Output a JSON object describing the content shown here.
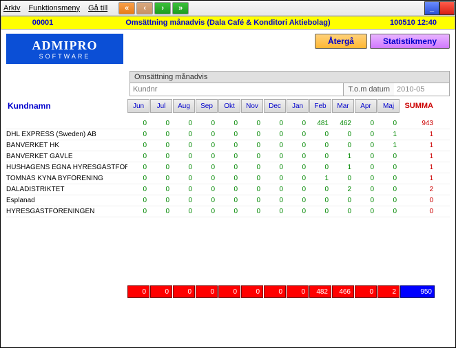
{
  "menu": {
    "arkiv": "Arkiv",
    "funk": "Funktionsmeny",
    "goto": "Gå till"
  },
  "header": {
    "left": "00001",
    "center": "Omsättning månadvis (Dala Café & Konditori Aktiebolag)",
    "right": "100510 12:40"
  },
  "logo": {
    "main": "ADMIPRO",
    "sub": "SOFTWARE"
  },
  "buttons": {
    "return": "Återgå",
    "stats": "Statistikmeny"
  },
  "filter": {
    "title": "Omsättning månadvis",
    "kundnr_ph": "Kundnr",
    "tom_lbl": "T.o.m datum",
    "tom_val": "2010-05"
  },
  "cols": {
    "kund": "Kundnamn",
    "months": [
      "Jun",
      "Jul",
      "Aug",
      "Sep",
      "Okt",
      "Nov",
      "Dec",
      "Jan",
      "Feb",
      "Mar",
      "Apr",
      "Maj"
    ],
    "summa": "SUMMA"
  },
  "rows": [
    {
      "name": "",
      "v": [
        0,
        0,
        0,
        0,
        0,
        0,
        0,
        0,
        481,
        462,
        0,
        0
      ],
      "sum": 943
    },
    {
      "name": "DHL EXPRESS (Sweden) AB",
      "v": [
        0,
        0,
        0,
        0,
        0,
        0,
        0,
        0,
        0,
        0,
        0,
        1
      ],
      "sum": 1
    },
    {
      "name": "BANVERKET HK",
      "v": [
        0,
        0,
        0,
        0,
        0,
        0,
        0,
        0,
        0,
        0,
        0,
        1
      ],
      "sum": 1
    },
    {
      "name": "BANVERKET GÄVLE",
      "v": [
        0,
        0,
        0,
        0,
        0,
        0,
        0,
        0,
        0,
        1,
        0,
        0
      ],
      "sum": 1
    },
    {
      "name": "HUSHAGENS EGNA HYRESGÄSTFÖR",
      "v": [
        0,
        0,
        0,
        0,
        0,
        0,
        0,
        0,
        0,
        1,
        0,
        0
      ],
      "sum": 1
    },
    {
      "name": "TOMNÄS KYNA BYFÖRENING ",
      "v": [
        0,
        0,
        0,
        0,
        0,
        0,
        0,
        0,
        1,
        0,
        0,
        0
      ],
      "sum": 1
    },
    {
      "name": "DALADISTRIKTET",
      "v": [
        0,
        0,
        0,
        0,
        0,
        0,
        0,
        0,
        0,
        2,
        0,
        0
      ],
      "sum": 2
    },
    {
      "name": "Esplanad",
      "v": [
        0,
        0,
        0,
        0,
        0,
        0,
        0,
        0,
        0,
        0,
        0,
        0
      ],
      "sum": 0
    },
    {
      "name": "HYRESGÄSTFÖRENINGEN",
      "v": [
        0,
        0,
        0,
        0,
        0,
        0,
        0,
        0,
        0,
        0,
        0,
        0
      ],
      "sum": 0
    }
  ],
  "totals": {
    "v": [
      0,
      0,
      0,
      0,
      0,
      0,
      0,
      0,
      482,
      466,
      0,
      2
    ],
    "sum": 950
  }
}
